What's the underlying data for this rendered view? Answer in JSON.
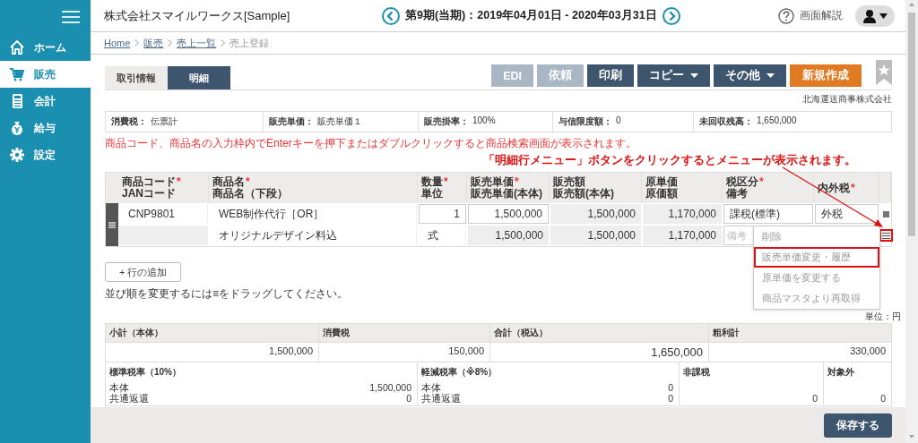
{
  "sidebar": {
    "items": [
      {
        "label": "ホーム",
        "selected": false
      },
      {
        "label": "販売",
        "selected": true
      },
      {
        "label": "会計",
        "selected": false
      },
      {
        "label": "給与",
        "selected": false
      },
      {
        "label": "設定",
        "selected": false
      }
    ]
  },
  "header": {
    "company": "株式会社スマイルワークス[Sample]",
    "period": "第9期(当期)：2019年04月01日 - 2020年03月31日",
    "help": "画面解説"
  },
  "breadcrumb": [
    {
      "label": "Home",
      "link": true
    },
    {
      "label": "販売",
      "link": true
    },
    {
      "label": "売上一覧",
      "link": true
    },
    {
      "label": "売上登録",
      "link": false
    }
  ],
  "tabs": [
    {
      "label": "取引情報",
      "selected": false
    },
    {
      "label": "明細",
      "selected": true
    }
  ],
  "actions": [
    {
      "label": "EDI",
      "kind": "plain",
      "disabled": true
    },
    {
      "label": "依頼",
      "kind": "plain",
      "disabled": true
    },
    {
      "label": "印刷",
      "kind": "plain",
      "disabled": false
    },
    {
      "label": "コピー",
      "kind": "dropdown",
      "disabled": false
    },
    {
      "label": "その他",
      "kind": "dropdown",
      "disabled": false
    },
    {
      "label": "新規作成",
      "kind": "primary",
      "disabled": false
    }
  ],
  "customer": "北海運送商事株式会社",
  "info": [
    {
      "label": "消費税：",
      "value": "伝票計"
    },
    {
      "label": "販売単価：",
      "value": "販売単価１"
    },
    {
      "label": "販売掛率：",
      "value": "100%"
    },
    {
      "label": "与信限度額：",
      "value": "0"
    },
    {
      "label": "未回収残高：",
      "value": "1,650,000"
    }
  ],
  "hint": "商品コード、商品名の入力枠内でEnterキーを押下またはダブルクリックすると商品検索画面が表示されます。",
  "annotation": "「明細行メニュー」ボタンをクリックするとメニューが表示されます。",
  "table": {
    "required_mark": "*",
    "columns": [
      {
        "line1": "商品コード",
        "line2": "JANコード",
        "required": true
      },
      {
        "line1": "商品名",
        "line2": "商品名（下段）",
        "required": true
      },
      {
        "line1": "数量",
        "line2": "単位",
        "required": true
      },
      {
        "line1": "販売単価",
        "line2": "販売単価(本体)",
        "required": true
      },
      {
        "line1": "販売額",
        "line2": "販売額(本体)",
        "required": false
      },
      {
        "line1": "原単価",
        "line2": "原価額",
        "required": false
      },
      {
        "line1": "税区分",
        "line2": "備考",
        "required": true
      },
      {
        "line1": "内外税",
        "required": true
      }
    ],
    "rows": [
      {
        "code": "CNP9801",
        "name": "WEB制作代行［OR］",
        "quantity": "1",
        "unit_price": "1,500,000",
        "amount": "1,500,000",
        "cost_price": "1,170,000",
        "tax_type": "課税(標準)",
        "tax_mode": "外税",
        "name2": "オリジナルデザイン料込",
        "unit": "式",
        "unit_price2": "1,500,000",
        "amount2": "1,500,000",
        "cost_amount": "1,170,000",
        "note_placeholder": "備考",
        "menu_button_highlighted": true,
        "menu": {
          "open": true,
          "items": [
            {
              "label": "削除",
              "highlighted": false
            },
            {
              "label": "販売単価変更・履歴",
              "highlighted": true
            },
            {
              "label": "原単価を変更する",
              "highlighted": false
            },
            {
              "label": "商品マスタより再取得",
              "highlighted": false
            }
          ]
        }
      }
    ]
  },
  "add_row": "+ 行の追加",
  "drag_hint": "並び順を変更するには≡をドラッグしてください。",
  "unit_note": "単位：円",
  "totals": [
    {
      "label": "小計（本体）",
      "value": "1,500,000",
      "emphasis": false
    },
    {
      "label": "消費税",
      "value": "150,000",
      "emphasis": false
    },
    {
      "label": "合計（税込）",
      "value": "1,650,000",
      "emphasis": true
    },
    {
      "label": "粗利計",
      "value": "330,000",
      "emphasis": false
    }
  ],
  "breakdown": [
    {
      "title": "標準税率（10%）",
      "rows": [
        {
          "label": "本体",
          "value": "1,500,000"
        },
        {
          "label": "共通返還",
          "value": "0"
        }
      ]
    },
    {
      "title": "軽減税率（※8%）",
      "rows": [
        {
          "label": "本体",
          "value": "0"
        },
        {
          "label": "共通返還",
          "value": "0"
        }
      ]
    },
    {
      "title": "非課税",
      "rows": [
        {
          "value": "0"
        }
      ]
    },
    {
      "title": "対象外",
      "rows": [
        {
          "value": "0"
        }
      ]
    }
  ],
  "save": "保存する"
}
